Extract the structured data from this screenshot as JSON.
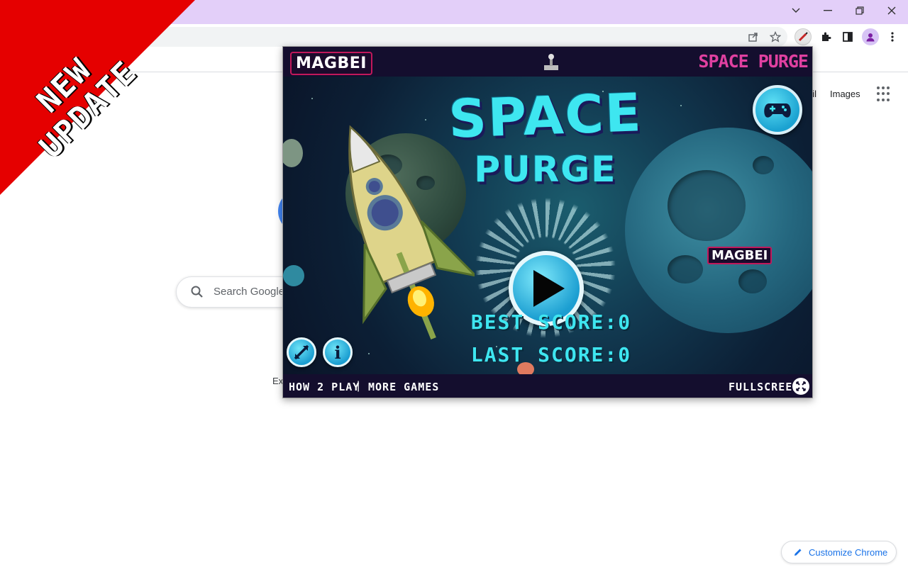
{
  "browser": {
    "window_controls": {
      "dropdown_icon": "chevron-down-icon",
      "minimize_icon": "minimize-icon",
      "restore_icon": "restore-icon",
      "close_icon": "close-icon"
    },
    "toolbar_icons": [
      "share-icon",
      "star-icon",
      "extension-icon",
      "puzzle-icon",
      "side-panel-icon",
      "profile-icon",
      "more-vert-icon"
    ]
  },
  "ntp": {
    "links": {
      "gmail": "ail",
      "images": "Images"
    },
    "search_placeholder": "Search Google",
    "ex_text": "Ex",
    "customize_label": "Customize Chrome"
  },
  "ribbon": {
    "line1": "NEW",
    "line2": "UPDATE",
    "color": "#e50000"
  },
  "game": {
    "brand": "MAGBEI",
    "header_title": "SPACE PURGE",
    "title_line1": "SPACE",
    "title_line2": "PURGE",
    "best_score": "BEST SCORE:0",
    "last_score": "LAST SCORE:0",
    "watermark": "MAGBEI",
    "footer": {
      "how_to_play": "HOW 2 PLAY",
      "separator": "|",
      "more_games": "MORE GAMES",
      "fullscreen": "FULLSCREEN"
    },
    "colors": {
      "title": "#3ee6f0",
      "header_accent": "#e040a0",
      "panel_bg": "#140e2e"
    }
  }
}
